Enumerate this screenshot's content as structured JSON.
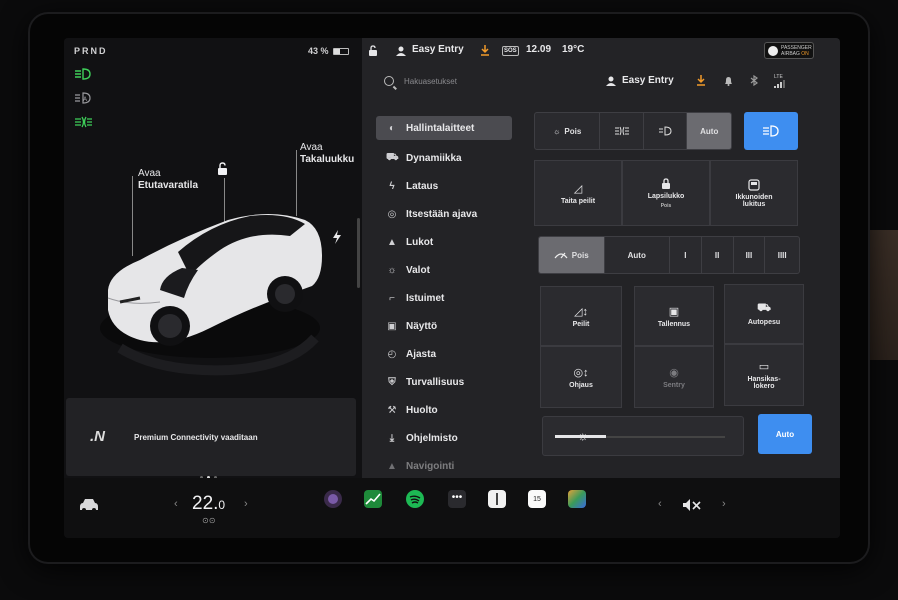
{
  "gear": "PRND",
  "battery": {
    "percent": "43 %",
    "level": 0.43
  },
  "car": {
    "frunk_action": "Avaa",
    "frunk_name": "Etutavaratila",
    "trunk_action": "Avaa",
    "trunk_name": "Takaluukku"
  },
  "connectivity": {
    "logo": ".N",
    "text": "Premium Connectivity vaaditaan"
  },
  "status": {
    "profile": "Easy Entry",
    "sos": "SOS",
    "time": "12.09",
    "temp": "19°C",
    "airbag_line1": "PASSENGER",
    "airbag_line2": "AIRBAG",
    "airbag_state": "ON",
    "lte": "LTE"
  },
  "search": {
    "placeholder": "Hakuasetukset"
  },
  "header_profile": "Easy Entry",
  "menu": [
    {
      "label": "Hallintalaitteet",
      "icon": "toggle-icon"
    },
    {
      "label": "Dynamiikka",
      "icon": "car-icon"
    },
    {
      "label": "Lataus",
      "icon": "bolt-icon"
    },
    {
      "label": "Itsestään ajava",
      "icon": "steering-wheel-icon"
    },
    {
      "label": "Lukot",
      "icon": "lock-icon"
    },
    {
      "label": "Valot",
      "icon": "sun-icon"
    },
    {
      "label": "Istuimet",
      "icon": "seat-icon"
    },
    {
      "label": "Näyttö",
      "icon": "display-icon"
    },
    {
      "label": "Ajasta",
      "icon": "alarm-clock-icon"
    },
    {
      "label": "Turvallisuus",
      "icon": "shield-icon"
    },
    {
      "label": "Huolto",
      "icon": "wrench-icon"
    },
    {
      "label": "Ohjelmisto",
      "icon": "download-icon"
    },
    {
      "label": "Navigointi",
      "icon": "navigation-icon"
    }
  ],
  "lights": {
    "off": "Pois",
    "auto": "Auto"
  },
  "row2": {
    "mirrors": "Taita peilit",
    "child_lock": "Lapsilukko",
    "child_lock_state": "Pois",
    "window_lock_1": "Ikkunoiden",
    "window_lock_2": "lukitus"
  },
  "wipers": {
    "off": "Pois",
    "auto": "Auto",
    "s1": "I",
    "s2": "II",
    "s3": "III",
    "s4": "IIII"
  },
  "tiles": {
    "mirrors": "Peilit",
    "dashcam": "Tallennus",
    "carwash": "Autopesu",
    "steering": "Ohjaus",
    "sentry": "Sentry",
    "glovebox_1": "Hansikas-",
    "glovebox_2": "lokero"
  },
  "brightness": {
    "auto": "Auto",
    "level": 0.3
  },
  "climate": {
    "temp_main": "22.",
    "temp_decimal": "0"
  },
  "calendar_day": "15"
}
